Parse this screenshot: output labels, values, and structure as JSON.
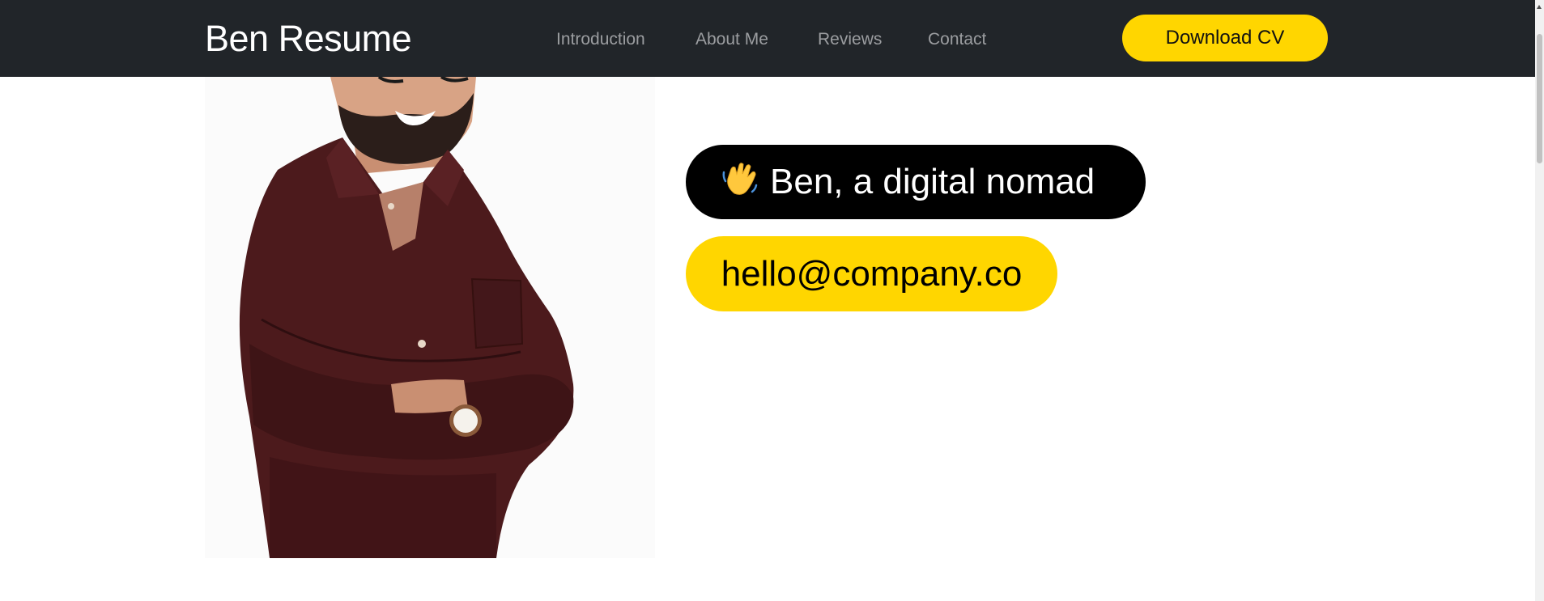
{
  "nav": {
    "brand": "Ben Resume",
    "links": [
      {
        "label": "Introduction"
      },
      {
        "label": "About Me"
      },
      {
        "label": "Reviews"
      },
      {
        "label": "Contact"
      }
    ],
    "cta_label": "Download CV"
  },
  "hero": {
    "greeting_icon": "waving-hand-icon",
    "greeting": "Ben, a digital nomad",
    "email": "hello@company.co"
  },
  "colors": {
    "navbar_bg": "#212529",
    "accent_yellow": "#ffd600",
    "nav_link": "#9b9da0",
    "pill_dark": "#000000"
  }
}
